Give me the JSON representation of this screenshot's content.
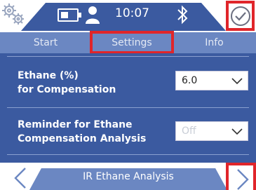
{
  "status_bar": {
    "time": "10:07",
    "icons": [
      "gears-icon",
      "battery-icon",
      "user-icon",
      "bluetooth-icon",
      "checkmark-icon"
    ]
  },
  "tabs": [
    {
      "label": "Start"
    },
    {
      "label": "Settings",
      "selected": true
    },
    {
      "label": "Info"
    }
  ],
  "settings": {
    "ethane": {
      "label_line1": "Ethane (%)",
      "label_line2": "for Compensation",
      "value": "6.0"
    },
    "reminder": {
      "label_line1": "Reminder for Ethane",
      "label_line2": "Compensation Analysis",
      "value": "Off"
    }
  },
  "footer": {
    "title": "IR Ethane Analysis"
  },
  "colors": {
    "primary": "#3b5aa0",
    "tab_bar": "#6b87c2",
    "highlight": "#e0252a"
  }
}
